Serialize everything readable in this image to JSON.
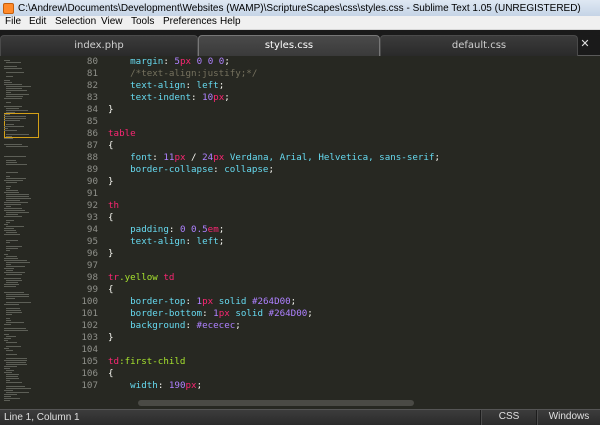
{
  "window": {
    "title": "C:\\Andrew\\Documents\\Development\\Websites (WAMP)\\ScriptureScapes\\css\\styles.css - Sublime Text 1.05 (UNREGISTERED)"
  },
  "menu": [
    "File",
    "Edit",
    "Selection",
    "View",
    "Tools",
    "Preferences",
    "Help"
  ],
  "tabs": [
    {
      "label": "index.php",
      "active": false
    },
    {
      "label": "styles.css",
      "active": true
    },
    {
      "label": "default.css",
      "active": false
    }
  ],
  "close_icon": "close-icon",
  "code_lines": [
    {
      "n": "80",
      "tokens": [
        [
          "    ",
          ""
        ],
        [
          "margin",
          "prop"
        ],
        [
          ": ",
          "punc"
        ],
        [
          "5",
          "num"
        ],
        [
          "px",
          "unit"
        ],
        [
          " ",
          ""
        ],
        [
          "0",
          "num"
        ],
        [
          " ",
          ""
        ],
        [
          "0",
          "num"
        ],
        [
          " ",
          ""
        ],
        [
          "0",
          "num"
        ],
        [
          ";",
          "punc"
        ]
      ]
    },
    {
      "n": "81",
      "tokens": [
        [
          "    ",
          ""
        ],
        [
          "/*text-align:justify;*/",
          "com"
        ]
      ]
    },
    {
      "n": "82",
      "tokens": [
        [
          "    ",
          ""
        ],
        [
          "text-align",
          "prop"
        ],
        [
          ": ",
          "punc"
        ],
        [
          "left",
          "prop"
        ],
        [
          ";",
          "punc"
        ]
      ]
    },
    {
      "n": "83",
      "tokens": [
        [
          "    ",
          ""
        ],
        [
          "text-indent",
          "prop"
        ],
        [
          ": ",
          "punc"
        ],
        [
          "10",
          "num"
        ],
        [
          "px",
          "unit"
        ],
        [
          ";",
          "punc"
        ]
      ]
    },
    {
      "n": "84",
      "tokens": [
        [
          "}",
          "punc"
        ]
      ]
    },
    {
      "n": "85",
      "tokens": []
    },
    {
      "n": "86",
      "tokens": [
        [
          "table",
          "sel"
        ]
      ]
    },
    {
      "n": "87",
      "tokens": [
        [
          "{",
          "punc"
        ]
      ]
    },
    {
      "n": "88",
      "tokens": [
        [
          "    ",
          ""
        ],
        [
          "font",
          "prop"
        ],
        [
          ": ",
          "punc"
        ],
        [
          "11",
          "num"
        ],
        [
          "px",
          "unit"
        ],
        [
          " / ",
          "punc"
        ],
        [
          "24",
          "num"
        ],
        [
          "px",
          "unit"
        ],
        [
          " ",
          ""
        ],
        [
          "Verdana, Arial, Helvetica, sans-serif",
          "prop"
        ],
        [
          ";",
          "punc"
        ]
      ]
    },
    {
      "n": "89",
      "tokens": [
        [
          "    ",
          ""
        ],
        [
          "border-collapse",
          "prop"
        ],
        [
          ": ",
          "punc"
        ],
        [
          "collapse",
          "prop"
        ],
        [
          ";",
          "punc"
        ]
      ]
    },
    {
      "n": "90",
      "tokens": [
        [
          "}",
          "punc"
        ]
      ]
    },
    {
      "n": "91",
      "tokens": []
    },
    {
      "n": "92",
      "tokens": [
        [
          "th",
          "sel"
        ]
      ]
    },
    {
      "n": "93",
      "tokens": [
        [
          "{",
          "punc"
        ]
      ]
    },
    {
      "n": "94",
      "tokens": [
        [
          "    ",
          ""
        ],
        [
          "padding",
          "prop"
        ],
        [
          ": ",
          "punc"
        ],
        [
          "0",
          "num"
        ],
        [
          " ",
          ""
        ],
        [
          "0.5",
          "num"
        ],
        [
          "em",
          "unit"
        ],
        [
          ";",
          "punc"
        ]
      ]
    },
    {
      "n": "95",
      "tokens": [
        [
          "    ",
          ""
        ],
        [
          "text-align",
          "prop"
        ],
        [
          ": ",
          "punc"
        ],
        [
          "left",
          "prop"
        ],
        [
          ";",
          "punc"
        ]
      ]
    },
    {
      "n": "96",
      "tokens": [
        [
          "}",
          "punc"
        ]
      ]
    },
    {
      "n": "97",
      "tokens": []
    },
    {
      "n": "98",
      "tokens": [
        [
          "tr",
          "sel"
        ],
        [
          ".yellow",
          "cls"
        ],
        [
          " ",
          ""
        ],
        [
          "td",
          "sel"
        ]
      ]
    },
    {
      "n": "99",
      "tokens": [
        [
          "{",
          "punc"
        ]
      ]
    },
    {
      "n": "100",
      "tokens": [
        [
          "    ",
          ""
        ],
        [
          "border-top",
          "prop"
        ],
        [
          ": ",
          "punc"
        ],
        [
          "1",
          "num"
        ],
        [
          "px",
          "unit"
        ],
        [
          " ",
          ""
        ],
        [
          "solid",
          "prop"
        ],
        [
          " ",
          ""
        ],
        [
          "#264D00",
          "num"
        ],
        [
          ";",
          "punc"
        ]
      ]
    },
    {
      "n": "101",
      "tokens": [
        [
          "    ",
          ""
        ],
        [
          "border-bottom",
          "prop"
        ],
        [
          ": ",
          "punc"
        ],
        [
          "1",
          "num"
        ],
        [
          "px",
          "unit"
        ],
        [
          " ",
          ""
        ],
        [
          "solid",
          "prop"
        ],
        [
          " ",
          ""
        ],
        [
          "#264D00",
          "num"
        ],
        [
          ";",
          "punc"
        ]
      ]
    },
    {
      "n": "102",
      "tokens": [
        [
          "    ",
          ""
        ],
        [
          "background",
          "prop"
        ],
        [
          ": ",
          "punc"
        ],
        [
          "#ececec",
          "num"
        ],
        [
          ";",
          "punc"
        ]
      ]
    },
    {
      "n": "103",
      "tokens": [
        [
          "}",
          "punc"
        ]
      ]
    },
    {
      "n": "104",
      "tokens": []
    },
    {
      "n": "105",
      "tokens": [
        [
          "td",
          "sel"
        ],
        [
          ":first-child",
          "cls"
        ]
      ]
    },
    {
      "n": "106",
      "tokens": [
        [
          "{",
          "punc"
        ]
      ]
    },
    {
      "n": "107",
      "tokens": [
        [
          "    ",
          ""
        ],
        [
          "width",
          "prop"
        ],
        [
          ": ",
          "punc"
        ],
        [
          "190",
          "num"
        ],
        [
          "px",
          "unit"
        ],
        [
          ";",
          "punc"
        ]
      ]
    }
  ],
  "status": {
    "position": "Line 1, Column 1",
    "syntax": "CSS",
    "line_endings": "Windows"
  },
  "colors": {
    "background": "#272822",
    "selector": "#f92672",
    "property": "#66d9ef",
    "number": "#ae81ff",
    "class": "#a6e22e",
    "comment": "#75715e"
  }
}
